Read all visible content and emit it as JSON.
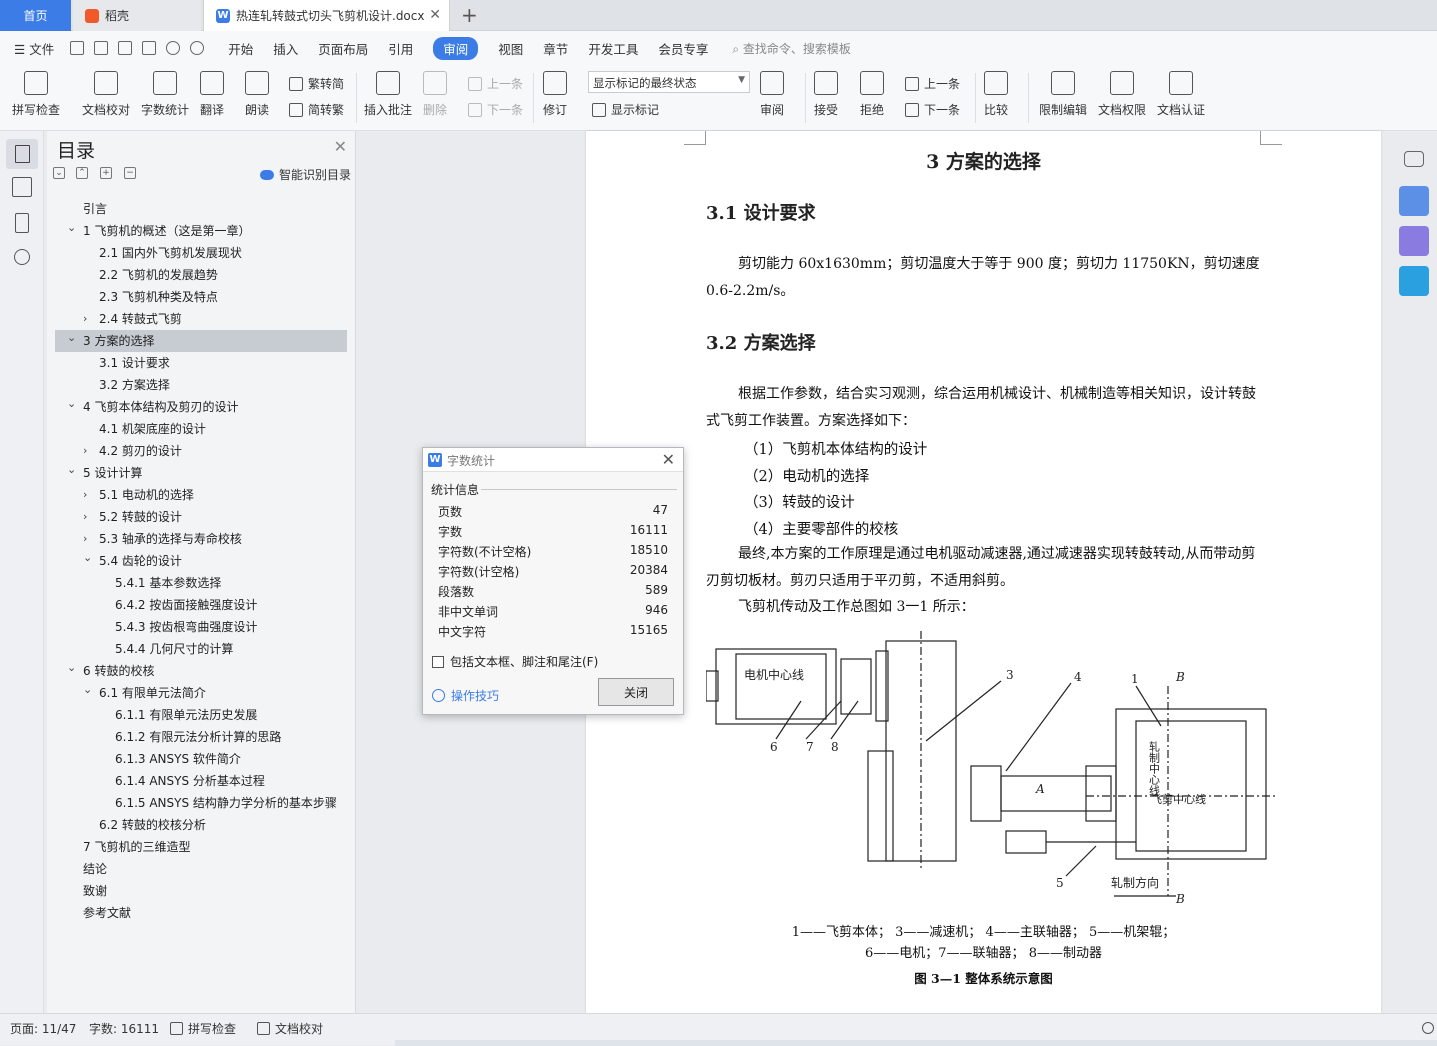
{
  "tabs": {
    "home": "首页",
    "daoke": "稻壳",
    "doc": "热连轧转鼓式切头飞剪机设计.docx"
  },
  "menu": {
    "file": "文件",
    "items": [
      "开始",
      "插入",
      "页面布局",
      "引用",
      "审阅",
      "视图",
      "章节",
      "开发工具",
      "会员专享"
    ],
    "active": "审阅",
    "search": "查找命令、搜索模板"
  },
  "ribbon": {
    "spell": "拼写检查",
    "proof": "文档校对",
    "count": "字数统计",
    "translate": "翻译",
    "read": "朗读",
    "trad": "繁转简",
    "simp": "简转繁",
    "insert_comment": "插入批注",
    "delete": "删除",
    "prev": "上一条",
    "next": "下一条",
    "revise": "修订",
    "markup_state": "显示标记的最终状态",
    "show_markup": "显示标记",
    "review": "审阅",
    "accept": "接受",
    "reject": "拒绝",
    "prev2": "上一条",
    "next2": "下一条",
    "compare": "比较",
    "restrict": "限制编辑",
    "perm": "文档权限",
    "cert": "文档认证"
  },
  "toc": {
    "title": "目录",
    "smart": "智能识别目录",
    "items": [
      {
        "t": "引言",
        "l": 0,
        "a": ""
      },
      {
        "t": "1 飞剪机的概述（这是第一章）",
        "l": 0,
        "a": "v"
      },
      {
        "t": "2.1 国内外飞剪机发展现状",
        "l": 1,
        "a": ""
      },
      {
        "t": "2.2 飞剪机的发展趋势",
        "l": 1,
        "a": ""
      },
      {
        "t": "2.3 飞剪机种类及特点",
        "l": 1,
        "a": ""
      },
      {
        "t": "2.4  转鼓式飞剪",
        "l": 1,
        "a": ">"
      },
      {
        "t": "3  方案的选择",
        "l": 0,
        "a": "v",
        "sel": true
      },
      {
        "t": "3.1  设计要求",
        "l": 1,
        "a": ""
      },
      {
        "t": "3.2  方案选择",
        "l": 1,
        "a": ""
      },
      {
        "t": "4 飞剪本体结构及剪刃的设计",
        "l": 0,
        "a": "v"
      },
      {
        "t": "4.1 机架底座的设计",
        "l": 1,
        "a": ""
      },
      {
        "t": "4.2 剪刃的设计",
        "l": 1,
        "a": ">"
      },
      {
        "t": "5  设计计算",
        "l": 0,
        "a": "v"
      },
      {
        "t": "5.1 电动机的选择",
        "l": 1,
        "a": ">"
      },
      {
        "t": "5.2  转鼓的设计",
        "l": 1,
        "a": ">"
      },
      {
        "t": "5.3 轴承的选择与寿命校核",
        "l": 1,
        "a": ">"
      },
      {
        "t": "5.4  齿轮的设计",
        "l": 1,
        "a": "v"
      },
      {
        "t": "5.4.1  基本参数选择",
        "l": 2,
        "a": ""
      },
      {
        "t": "6.4.2  按齿面接触强度设计",
        "l": 2,
        "a": ""
      },
      {
        "t": "5.4.3 按齿根弯曲强度设计",
        "l": 2,
        "a": ""
      },
      {
        "t": "5.4.4  几何尺寸的计算",
        "l": 2,
        "a": ""
      },
      {
        "t": "6  转鼓的校核",
        "l": 0,
        "a": "v"
      },
      {
        "t": "6.1 有限单元法简介",
        "l": 1,
        "a": "v"
      },
      {
        "t": "6.1.1  有限单元法历史发展",
        "l": 2,
        "a": ""
      },
      {
        "t": "6.1.2 有限元法分析计算的思路",
        "l": 2,
        "a": ""
      },
      {
        "t": "6.1.3    ANSYS 软件简介",
        "l": 2,
        "a": ""
      },
      {
        "t": "6.1.4    ANSYS 分析基本过程",
        "l": 2,
        "a": ""
      },
      {
        "t": "6.1.5 ANSYS 结构静力学分析的基本步骤",
        "l": 2,
        "a": ""
      },
      {
        "t": "6.2  转鼓的校核分析",
        "l": 1,
        "a": ""
      },
      {
        "t": "7 飞剪机的三维造型",
        "l": 0,
        "a": ""
      },
      {
        "t": "结论",
        "l": 0,
        "a": ""
      },
      {
        "t": "致谢",
        "l": 0,
        "a": ""
      },
      {
        "t": "参考文献",
        "l": 0,
        "a": ""
      }
    ]
  },
  "doc": {
    "chapter": "3  方案的选择",
    "h31": "3.1  设计要求",
    "p1": "剪切能力 60x1630mm；剪切温度大于等于 900 度；剪切力 11750KN，剪切速度 0.6-2.2m/s。",
    "h32": "3.2  方案选择",
    "p2": "根据工作参数，结合实习观测，综合运用机械设计、机械制造等相关知识，设计转鼓式飞剪工作装置。方案选择如下：",
    "list": [
      "（1）飞剪机本体结构的设计",
      "（2）电动机的选择",
      "（3）转鼓的设计",
      "（4）主要零部件的校核"
    ],
    "p3": "最终,本方案的工作原理是通过电机驱动减速器,通过减速器实现转鼓转动,从而带动剪刃剪切板材。剪刃只适用于平刃剪，不适用斜剪。",
    "p4": "飞剪机传动及工作总图如 3一1 所示：",
    "fig": {
      "motor": "电机中心线",
      "shear": "飞剪中心线",
      "roll": "轧制中心线",
      "dir": "轧制方向",
      "n1": "1",
      "n3": "3",
      "n4": "4",
      "n5": "5",
      "n6": "6",
      "n7": "7",
      "n8": "8",
      "A": "A",
      "B1": "B",
      "B2": "B"
    },
    "cap1": "1——飞剪本体；  3——减速机；  4——主联轴器；   5——机架辊；",
    "cap2": "6——电机；7——联轴器；  8——制动器",
    "cap3": "图 3—1 整体系统示意图"
  },
  "dialog": {
    "title": "字数统计",
    "group": "统计信息",
    "rows": [
      {
        "k": "页数",
        "v": "47"
      },
      {
        "k": "字数",
        "v": "16111"
      },
      {
        "k": "字符数(不计空格)",
        "v": "18510"
      },
      {
        "k": "字符数(计空格)",
        "v": "20384"
      },
      {
        "k": "段落数",
        "v": "589"
      },
      {
        "k": "非中文单词",
        "v": "946"
      },
      {
        "k": "中文字符",
        "v": "15165"
      }
    ],
    "checkbox": "包括文本框、脚注和尾注(F)",
    "tips": "操作技巧",
    "close": "关闭"
  },
  "status": {
    "page": "页面: 11/47",
    "words": "字数: 16111",
    "spell": "拼写检查",
    "proof": "文档校对"
  },
  "colors": {
    "accent": "#3b7ce6"
  }
}
